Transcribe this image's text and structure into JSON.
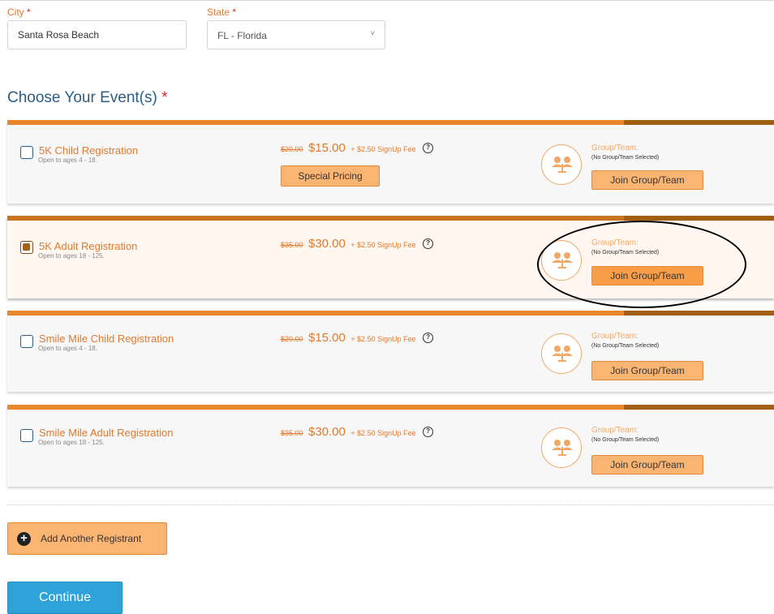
{
  "address": {
    "city_label": "City",
    "city_value": "Santa Rosa Beach",
    "state_label": "State",
    "state_value": "FL - Florida",
    "required_mark": "*"
  },
  "events_section": {
    "title": "Choose Your Event(s)",
    "required_mark": "*",
    "events": [
      {
        "name": "5K Child Registration",
        "ages": "Open to ages 4 - 18.",
        "old_price": "$20.00",
        "price": "$15.00",
        "fee": "+ $2.50 SignUp Fee",
        "checked": false,
        "special_label": "Special Pricing",
        "group_label": "Group/Team:",
        "group_none": "(No Group/Team Selected)",
        "join_label": "Join Group/Team"
      },
      {
        "name": "5K Adult Registration",
        "ages": "Open to ages 18 - 125.",
        "old_price": "$35.00",
        "price": "$30.00",
        "fee": "+ $2.50 SignUp Fee",
        "checked": true,
        "group_label": "Group/Team:",
        "group_none": "(No Group/Team Selected)",
        "join_label": "Join Group/Team"
      },
      {
        "name": "Smile Mile Child Registration",
        "ages": "Open to ages 4 - 18.",
        "old_price": "$20.00",
        "price": "$15.00",
        "fee": "+ $2.50 SignUp Fee",
        "checked": false,
        "group_label": "Group/Team:",
        "group_none": "(No Group/Team Selected)",
        "join_label": "Join Group/Team"
      },
      {
        "name": "Smile Mile Adult Registration",
        "ages": "Open to ages 18 - 125.",
        "old_price": "$35.00",
        "price": "$30.00",
        "fee": "+ $2.50 SignUp Fee",
        "checked": false,
        "group_label": "Group/Team:",
        "group_none": "(No Group/Team Selected)",
        "join_label": "Join Group/Team"
      }
    ]
  },
  "help_glyph": "?",
  "add_registrant_label": "Add Another Registrant",
  "plus_glyph": "+",
  "continue_label": "Continue",
  "select_chevron": "˅",
  "colors": {
    "accent_orange": "#e07a2f",
    "button_orange": "#fbb573",
    "title_blue": "#2b5d85",
    "continue_blue": "#2ea3d9"
  },
  "icons": {
    "group": "group-team-icon",
    "help": "help-icon",
    "add": "plus-circle-icon",
    "chevron": "chevron-down-icon"
  }
}
